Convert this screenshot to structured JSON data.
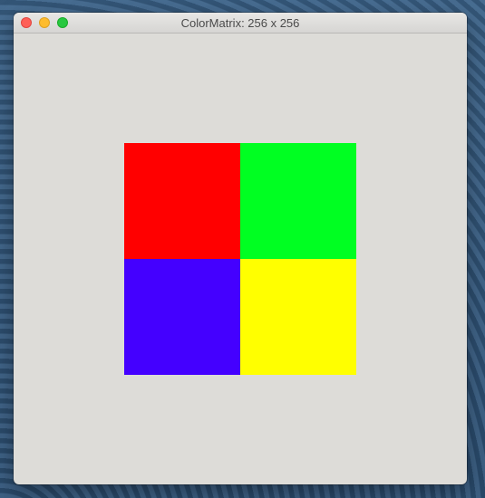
{
  "window": {
    "title": "ColorMatrix: 256 x 256"
  },
  "matrix": {
    "cells": [
      {
        "color": "#ff0000"
      },
      {
        "color": "#00ff22"
      },
      {
        "color": "#4400ff"
      },
      {
        "color": "#ffff00"
      }
    ]
  }
}
